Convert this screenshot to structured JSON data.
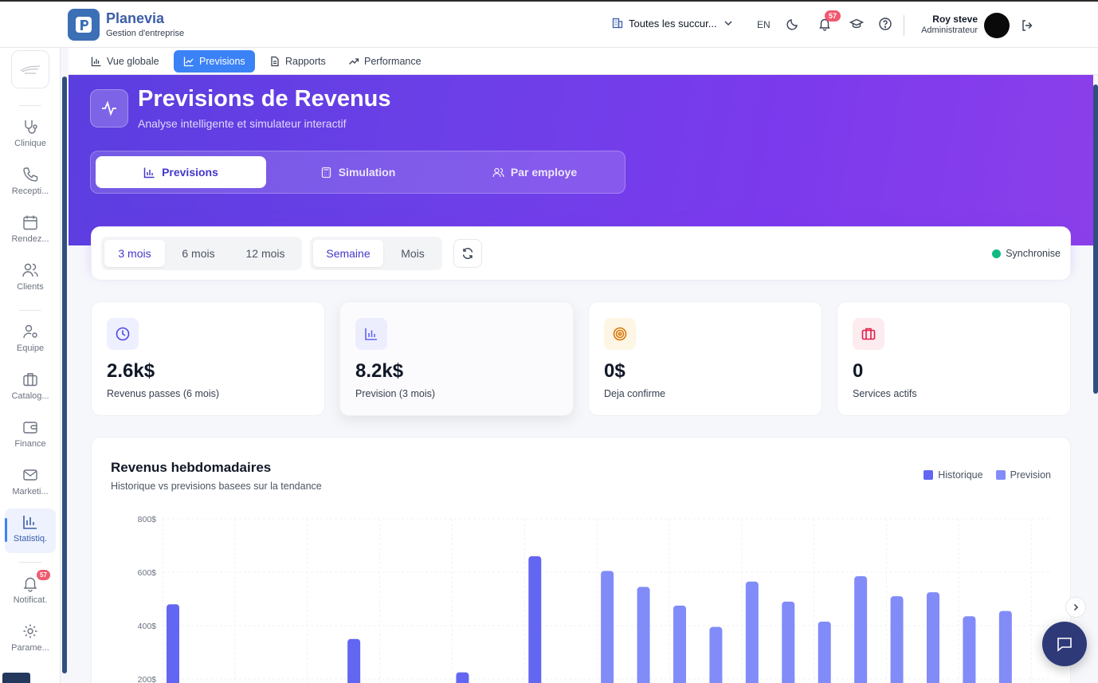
{
  "brand": {
    "name": "Planevia",
    "subtitle": "Gestion d'entreprise"
  },
  "header": {
    "branch_select": "Toutes les succur...",
    "language": "EN",
    "notification_count": "57",
    "user_name": "Roy steve",
    "user_role": "Administrateur"
  },
  "sidebar": {
    "items": [
      {
        "label": "Clinique",
        "icon": "stethoscope-icon"
      },
      {
        "label": "Recepti...",
        "icon": "phone-icon"
      },
      {
        "label": "Rendez...",
        "icon": "calendar-icon"
      },
      {
        "label": "Clients",
        "icon": "users-icon"
      },
      {
        "label": "Equipe",
        "icon": "user-cog-icon"
      },
      {
        "label": "Catalog...",
        "icon": "briefcase-icon"
      },
      {
        "label": "Finance",
        "icon": "wallet-icon"
      },
      {
        "label": "Marketi...",
        "icon": "mail-icon"
      },
      {
        "label": "Statistiq.",
        "icon": "bar-chart-icon",
        "active": true
      },
      {
        "label": "Notificat.",
        "icon": "bell-icon",
        "badge": "57"
      },
      {
        "label": "Parame...",
        "icon": "gear-icon"
      }
    ]
  },
  "main_tabs": [
    {
      "label": "Vue globale",
      "icon": "bar-chart-icon"
    },
    {
      "label": "Previsions",
      "icon": "line-chart-icon",
      "active": true
    },
    {
      "label": "Rapports",
      "icon": "document-icon"
    },
    {
      "label": "Performance",
      "icon": "trending-up-icon"
    }
  ],
  "hero": {
    "title": "Previsions de Revenus",
    "subtitle": "Analyse intelligente et simulateur interactif",
    "tabs": [
      {
        "label": "Previsions",
        "icon": "bar-chart-icon",
        "active": true
      },
      {
        "label": "Simulation",
        "icon": "calculator-icon"
      },
      {
        "label": "Par employe",
        "icon": "users-icon"
      }
    ]
  },
  "filters": {
    "horizon": [
      "3 mois",
      "6 mois",
      "12 mois"
    ],
    "horizon_selected": "3 mois",
    "granularity": [
      "Semaine",
      "Mois"
    ],
    "granularity_selected": "Semaine",
    "sync_status": "Synchronise",
    "sync_color": "#10b981"
  },
  "stats": [
    {
      "value": "2.6k$",
      "label": "Revenus passes (6 mois)",
      "icon": "clock-icon",
      "color": "#4f46e5",
      "bg": "#eef0ff"
    },
    {
      "value": "8.2k$",
      "label": "Prevision (3 mois)",
      "icon": "bar-chart-icon",
      "color": "#6366f1",
      "bg": "#eceefe"
    },
    {
      "value": "0$",
      "label": "Deja confirme",
      "icon": "target-icon",
      "color": "#d97706",
      "bg": "#fef6e4"
    },
    {
      "value": "0",
      "label": "Services actifs",
      "icon": "briefcase-icon",
      "color": "#e11d48",
      "bg": "#fdecef"
    }
  ],
  "chart": {
    "title": "Revenus hebdomadaires",
    "subtitle": "Historique vs previsions basees sur la tendance",
    "legend": [
      {
        "name": "Historique",
        "color": "#6366f1"
      },
      {
        "name": "Prevision",
        "color": "#818cf8"
      }
    ]
  },
  "chart_data": {
    "type": "bar",
    "title": "Revenus hebdomadaires",
    "ylim": [
      200,
      800
    ],
    "yticks": [
      "800$",
      "600$",
      "400$",
      "200$"
    ],
    "ytick_values": [
      800,
      600,
      400,
      200
    ],
    "series": [
      {
        "name": "Historique",
        "color": "#6366f1",
        "values": [
          480,
          0,
          0,
          0,
          0,
          350,
          0,
          0,
          225,
          0,
          660,
          0,
          0,
          0,
          0,
          0,
          0,
          0,
          0,
          0,
          0,
          0,
          0,
          0,
          0
        ]
      },
      {
        "name": "Prevision",
        "color": "#818cf8",
        "values": [
          0,
          0,
          0,
          0,
          0,
          0,
          0,
          0,
          0,
          0,
          0,
          0,
          605,
          545,
          475,
          395,
          565,
          490,
          415,
          585,
          510,
          525,
          435,
          455,
          0
        ]
      }
    ]
  }
}
